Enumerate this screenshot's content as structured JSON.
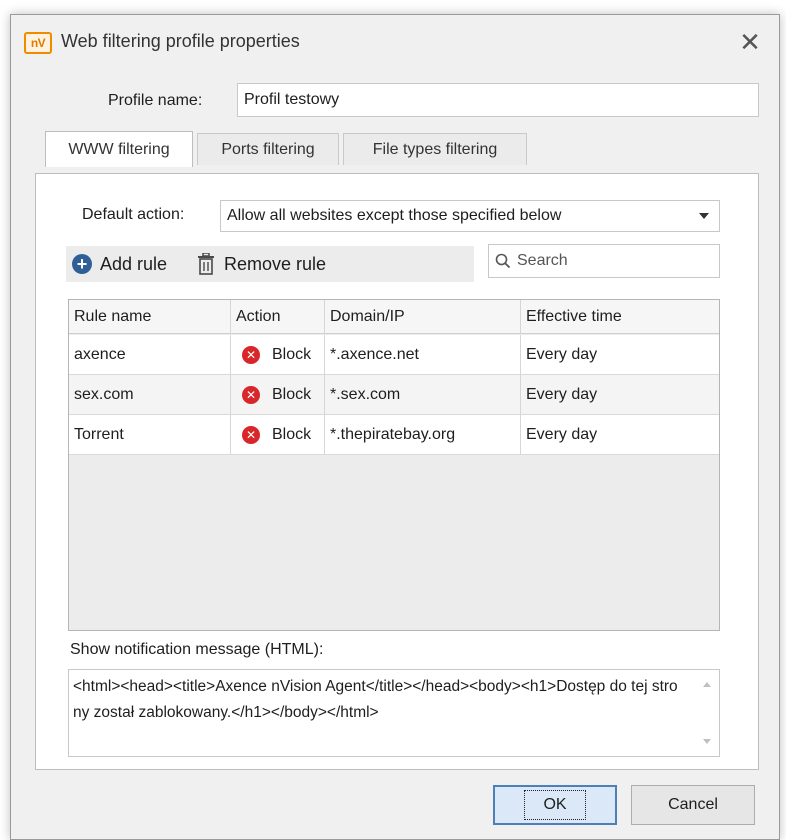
{
  "window": {
    "icon_text": "nV",
    "title": "Web filtering profile properties"
  },
  "profile": {
    "label": "Profile name:",
    "value": "Profil testowy"
  },
  "tabs": [
    {
      "label": "WWW filtering",
      "active": true
    },
    {
      "label": "Ports filtering",
      "active": false
    },
    {
      "label": "File types filtering",
      "active": false
    }
  ],
  "default_action": {
    "label": "Default action:",
    "selected": "Allow all websites except those specified below"
  },
  "toolbar": {
    "add_label": "Add rule",
    "remove_label": "Remove rule"
  },
  "search": {
    "placeholder": "Search"
  },
  "grid": {
    "columns": [
      "Rule name",
      "Action",
      "Domain/IP",
      "Effective time"
    ],
    "rows": [
      {
        "name": "axence",
        "action": "Block",
        "domain": "*.axence.net",
        "time": "Every day"
      },
      {
        "name": "sex.com",
        "action": "Block",
        "domain": "*.sex.com",
        "time": "Every day"
      },
      {
        "name": "Torrent",
        "action": "Block",
        "domain": "*.thepiratebay.org",
        "time": "Every day"
      }
    ]
  },
  "notification": {
    "label": "Show notification message (HTML):",
    "value": "<html><head><title>Axence nVision Agent</title></head><body><h1>Dostęp do tej strony został zablokowany.</h1></body></html>"
  },
  "buttons": {
    "ok_label": "OK",
    "cancel_label": "Cancel"
  },
  "colors": {
    "accent": "#2f5f96",
    "block_icon": "#d9262b",
    "app_icon": "#f08a00"
  }
}
